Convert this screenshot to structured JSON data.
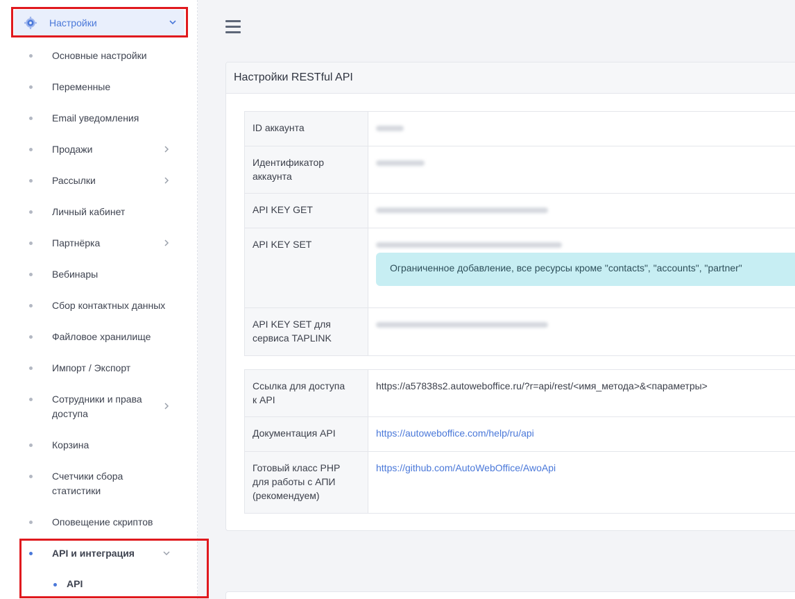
{
  "sidebar": {
    "header": {
      "label": "Настройки",
      "icon": "gear-icon",
      "accent": "#4a78d9"
    },
    "items": [
      {
        "label": "Основные настройки"
      },
      {
        "label": "Переменные"
      },
      {
        "label": "Email уведомления"
      },
      {
        "label": "Продажи",
        "has_arrow": true
      },
      {
        "label": "Рассылки",
        "has_arrow": true
      },
      {
        "label": "Личный кабинет"
      },
      {
        "label": "Партнёрка",
        "has_arrow": true
      },
      {
        "label": "Вебинары"
      },
      {
        "label": "Сбор контактных данных"
      },
      {
        "label": "Файловое хранилище"
      },
      {
        "label": "Импорт / Экспорт"
      },
      {
        "label_line1": "Сотрудники и права",
        "label_line2": "доступа",
        "has_arrow": true
      },
      {
        "label": "Корзина"
      },
      {
        "label_line1": "Счетчики сбора",
        "label_line2": "статистики"
      },
      {
        "label": "Оповещение скриптов"
      },
      {
        "label": "API и интеграция",
        "active": true,
        "expanded": true
      }
    ],
    "sub_item": {
      "label": "API"
    }
  },
  "main": {
    "card_title": "Настройки RESTful API",
    "table1": {
      "rows": [
        {
          "key": "ID аккаунта"
        },
        {
          "key_line1": "Идентификатор",
          "key_line2": "аккаунта"
        },
        {
          "key": "API KEY GET"
        },
        {
          "key": "API KEY SET",
          "note": "Ограниченное добавление, все ресурсы кроме \"contacts\", \"accounts\", \"partner\""
        },
        {
          "key_line1": "API KEY SET для",
          "key_line2": "сервиса TAPLINK"
        }
      ]
    },
    "table2": {
      "rows": [
        {
          "key_line1": "Ссылка для доступа",
          "key_line2": "к API",
          "value": "https://a57838s2.autoweboffice.ru/?r=api/rest/<имя_метода>&<параметры>"
        },
        {
          "key": "Документация API",
          "value": "https://autoweboffice.com/help/ru/api"
        },
        {
          "key_line1": "Готовый класс PHP",
          "key_line2": "для работы с АПИ",
          "key_line3": "(рекомендуем)",
          "value": "https://github.com/AutoWebOffice/AwoApi"
        }
      ]
    }
  },
  "colors": {
    "highlight_box": "#e0191e",
    "link": "#4a78d9",
    "alert_bg": "#c7eef3"
  }
}
